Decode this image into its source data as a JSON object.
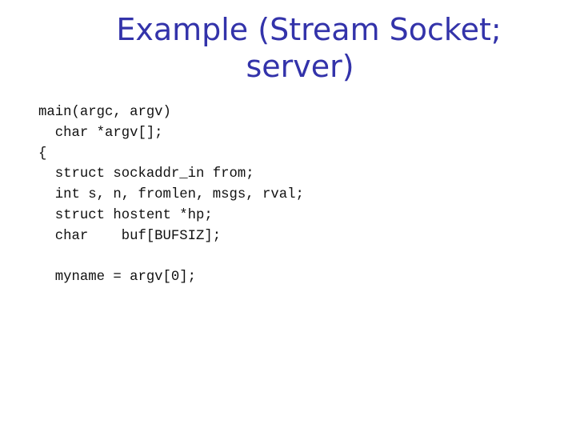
{
  "slide": {
    "title_lines": [
      "Example (Stream Socket;",
      "server)"
    ],
    "code_lines": [
      "main(argc, argv)",
      "  char *argv[];",
      "{",
      "  struct sockaddr_in from;",
      "  int s, n, fromlen, msgs, rval;",
      "  struct hostent *hp;",
      "  char    buf[BUFSIZ];",
      "",
      "  myname = argv[0];"
    ]
  },
  "colors": {
    "title": "#3333aa",
    "code": "#111111",
    "background": "#ffffff"
  }
}
